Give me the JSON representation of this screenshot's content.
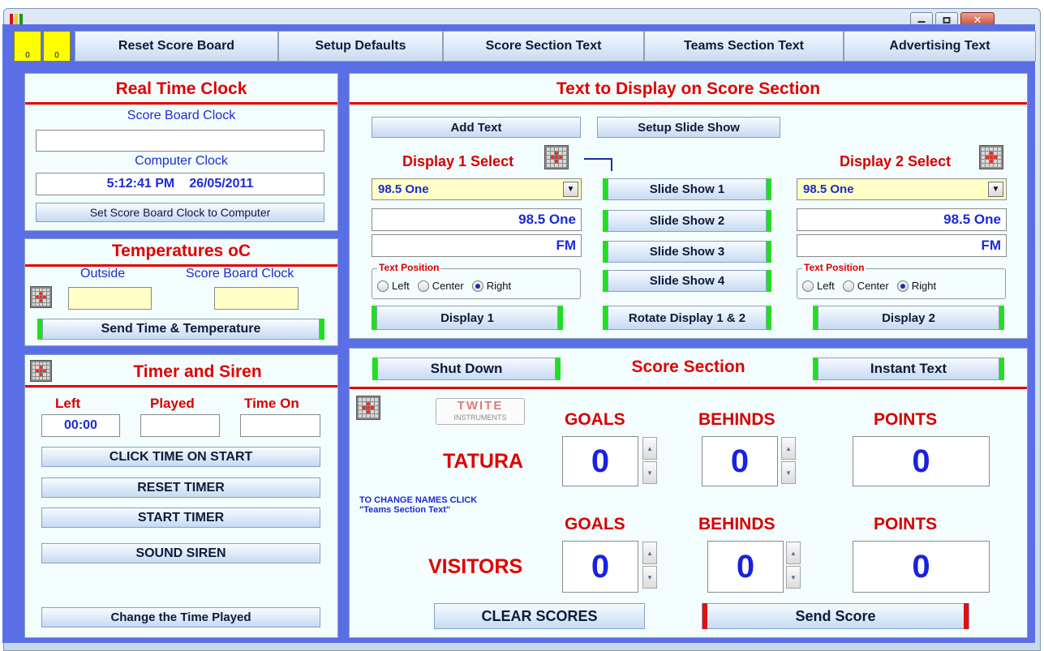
{
  "colors": {
    "background": "#5a6fe6",
    "panel": "#f3fdfd",
    "title_red": "#e00000",
    "text_blue": "#1b2bd6",
    "green_bar": "#22dd22",
    "red_bar": "#e01010"
  },
  "window": {
    "controls": [
      "minimize-icon",
      "maximize-icon",
      "close-icon"
    ]
  },
  "counters": [
    "0",
    "0"
  ],
  "menu": [
    "Reset Score Board",
    "Setup Defaults",
    "Score Section Text",
    "Teams Section Text",
    "Advertising Text"
  ],
  "rtc": {
    "title": "Real Time Clock",
    "scoreboard_label": "Score Board Clock",
    "scoreboard_value": "",
    "computer_label": "Computer Clock",
    "computer_time": "5:12:41 PM",
    "computer_date": "26/05/2011",
    "set_button": "Set Score Board Clock to Computer"
  },
  "temps": {
    "title": "Temperatures oC",
    "outside_label": "Outside",
    "clock_label": "Score Board Clock",
    "outside_value": "",
    "clock_value": "",
    "send_button": "Send Time & Temperature"
  },
  "timer": {
    "title": "Timer and Siren",
    "left_label": "Left",
    "played_label": "Played",
    "timeon_label": "Time On",
    "left_value": "00:00",
    "played_value": "",
    "timeon_value": "",
    "buttons": [
      "CLICK TIME ON START",
      "RESET TIMER",
      "START TIMER",
      "SOUND SIREN"
    ],
    "change_button": "Change the Time Played"
  },
  "text_display": {
    "title": "Text to Display on Score Section",
    "add_text": "Add Text",
    "setup_slide": "Setup Slide Show",
    "d1_label": "Display 1 Select",
    "d2_label": "Display 2 Select",
    "d1_select": "98.5 One",
    "d2_select": "98.5 One",
    "d1_line1": "98.5 One",
    "d1_line2": "FM",
    "d2_line1": "98.5 One",
    "d2_line2": "FM",
    "slides": [
      "Slide Show 1",
      "Slide Show 2",
      "Slide Show 3",
      "Slide Show 4"
    ],
    "text_position": "Text Position",
    "positions": [
      "Left",
      "Center",
      "Right"
    ],
    "selected_position": "Right",
    "display1": "Display 1",
    "display2": "Display 2",
    "rotate": "Rotate Display 1 & 2"
  },
  "score": {
    "title": "Score Section",
    "shutdown": "Shut Down",
    "instant": "Instant Text",
    "logo_top": "TWITE",
    "logo_bottom": "INSTRUMENTS",
    "col_goals": "GOALS",
    "col_behinds": "BEHINDS",
    "col_points": "POINTS",
    "team1": {
      "name": "TATURA",
      "goals": "0",
      "behinds": "0",
      "points": "0"
    },
    "team2": {
      "name": "VISITORS",
      "goals": "0",
      "behinds": "0",
      "points": "0"
    },
    "hint_line1": "TO CHANGE NAMES CLICK",
    "hint_line2": "\"Teams Section Text\"",
    "clear": "CLEAR SCORES",
    "send": "Send Score"
  }
}
